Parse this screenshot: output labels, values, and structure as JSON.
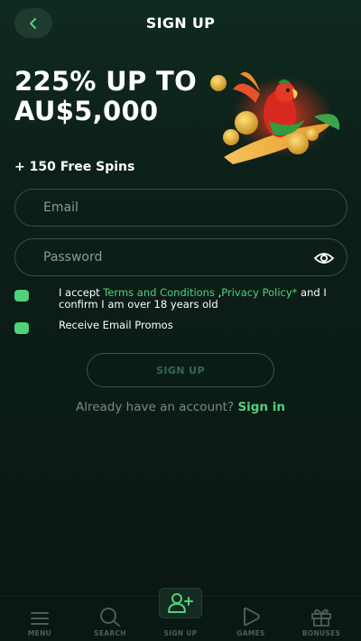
{
  "header": {
    "title": "SIGN UP"
  },
  "promo": {
    "title": "225% UP TO AU$5,000",
    "subtitle": "+ 150 Free Spins"
  },
  "form": {
    "email_placeholder": "Email",
    "password_placeholder": "Password",
    "terms": {
      "prefix": "I accept ",
      "terms_link": "Terms and Conditions",
      "separator": " ,",
      "privacy_link": "Privacy Policy*",
      "suffix": " and I confirm I am over 18 years old",
      "checked": true
    },
    "promos": {
      "label": "Receive Email Promos",
      "checked": true
    },
    "submit_label": "SIGN UP"
  },
  "login": {
    "prompt": "Already have an account?",
    "link": "Sign in"
  },
  "nav": {
    "items": [
      {
        "label": "MENU",
        "icon": "menu-icon"
      },
      {
        "label": "SEARCH",
        "icon": "search-icon"
      },
      {
        "label": "SIGN UP",
        "icon": "add-user-icon"
      },
      {
        "label": "GAMES",
        "icon": "play-icon"
      },
      {
        "label": "BONUSES",
        "icon": "gift-icon"
      }
    ]
  },
  "colors": {
    "accent": "#4fd27a",
    "background": "#0b1a15",
    "muted": "#7a8a83"
  }
}
